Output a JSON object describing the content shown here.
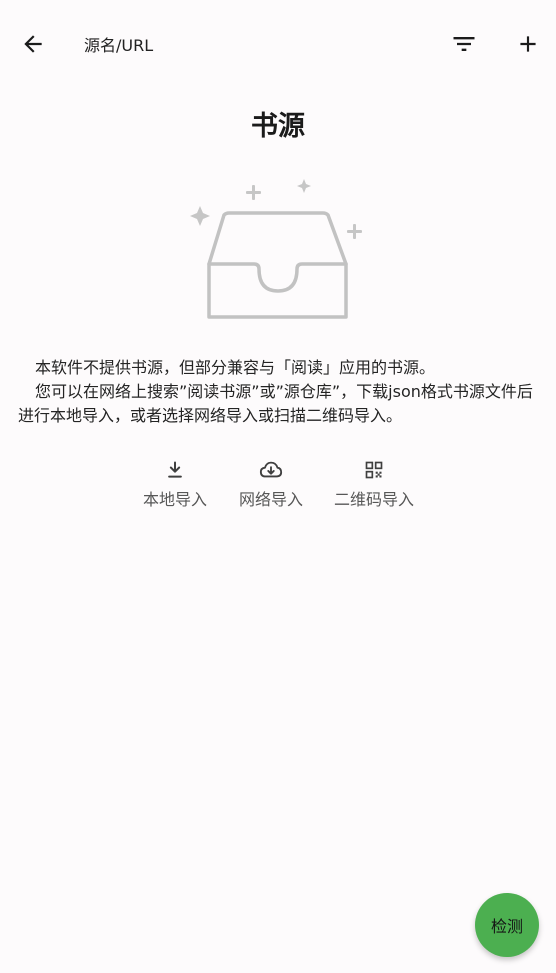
{
  "header": {
    "search_placeholder": "源名/URL",
    "back_icon": "arrow-left-icon",
    "filter_icon": "filter-list-icon",
    "add_icon": "plus-icon"
  },
  "empty_state": {
    "title": "书源",
    "illustration_icon": "empty-inbox-icon",
    "paragraphs": [
      "本软件不提供书源，但部分兼容与「阅读」应用的书源。",
      "您可以在网络上搜索”阅读书源”或”源仓库”，下载json格式书源文件后进行本地导入，或者选择网络导入或扫描二维码导入。"
    ]
  },
  "actions": {
    "local": {
      "label": "本地导入",
      "icon": "download-icon"
    },
    "network": {
      "label": "网络导入",
      "icon": "cloud-download-icon"
    },
    "qrcode": {
      "label": "二维码导入",
      "icon": "qr-code-icon"
    }
  },
  "fab": {
    "label": "检测",
    "color": "#4caf50"
  }
}
